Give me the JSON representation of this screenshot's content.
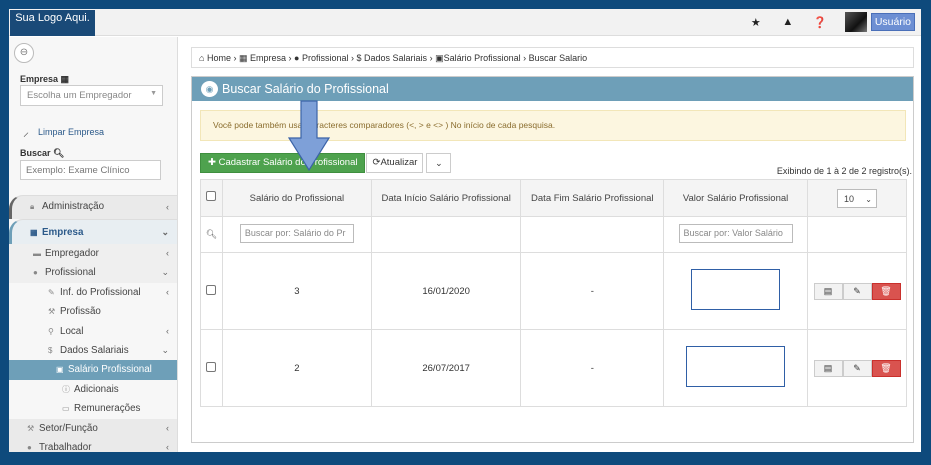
{
  "topbar": {
    "logo": "Sua Logo Aqui.",
    "user_button": "Usuário",
    "icons": [
      "star-icon",
      "warning-icon",
      "help-icon"
    ]
  },
  "sidebar": {
    "empresa_label": "Empresa",
    "empresa_select_placeholder": "Escolha um Empregador",
    "clear_link": "Limpar Empresa",
    "search_label": "Buscar",
    "search_placeholder": "Exemplo: Exame Clínico",
    "menu": [
      {
        "label": "Administração",
        "icon": "lock-icon",
        "level": 0,
        "chevron": "‹"
      },
      {
        "label": "Empresa",
        "icon": "building-icon",
        "level": 0,
        "chevron": "⌄"
      },
      {
        "label": "Empregador",
        "icon": "briefcase-icon",
        "level": 1,
        "chevron": "‹"
      },
      {
        "label": "Profissional",
        "icon": "user-icon",
        "level": 1,
        "chevron": "⌄"
      },
      {
        "label": "Inf. do Profissional",
        "icon": "pencil-icon",
        "level": 2,
        "chevron": "‹"
      },
      {
        "label": "Profissão",
        "icon": "wrench-icon",
        "level": 2,
        "chevron": ""
      },
      {
        "label": "Local",
        "icon": "map-marker-icon",
        "level": 2,
        "chevron": "‹"
      },
      {
        "label": "Dados Salariais",
        "icon": "dollar-icon",
        "level": 2,
        "chevron": "⌄"
      },
      {
        "label": "Salário Profissional",
        "icon": "money-icon",
        "level": 3,
        "chevron": "",
        "active": true
      },
      {
        "label": "Adicionais",
        "icon": "info-icon",
        "level": 3,
        "chevron": ""
      },
      {
        "label": "Remunerações",
        "icon": "card-icon",
        "level": 3,
        "chevron": ""
      },
      {
        "label": "Setor/Função",
        "icon": "wrench-icon",
        "level": 1,
        "chevron": "‹"
      },
      {
        "label": "Trabalhador",
        "icon": "user-icon",
        "level": 1,
        "chevron": "‹"
      }
    ]
  },
  "breadcrumb": {
    "items": [
      "Home",
      "Empresa",
      "Profissional",
      "Dados Salariais",
      "Salário Profissional",
      "Buscar Salario"
    ]
  },
  "panel": {
    "title": "Buscar Salário do Profissional",
    "alert": "Você pode também usar caracteres comparadores (<, > e <> ) No início de cada pesquisa.",
    "add_button": "Cadastrar Salário do Profissional",
    "refresh_button": "Atualizar",
    "count_text": "Exibindo de 1 à 2 de 2 registro(s).",
    "page_size": "10",
    "columns": [
      "Salário do Profissional",
      "Data Início Salário Profissional",
      "Data Fim Salário Profissional",
      "Valor Salário Profissional"
    ],
    "filter_salario_placeholder": "Buscar por: Salário do Pr",
    "filter_valor_placeholder": "Buscar por: Valor Salário",
    "rows": [
      {
        "salario": "3",
        "inicio": "16/01/2020",
        "fim": "-"
      },
      {
        "salario": "2",
        "inicio": "26/07/2017",
        "fim": "-"
      }
    ]
  },
  "colors": {
    "header": "#6e9fb8",
    "add_button": "#4ea24e",
    "delete_button": "#d9534f",
    "frame": "#0e4a7c"
  }
}
